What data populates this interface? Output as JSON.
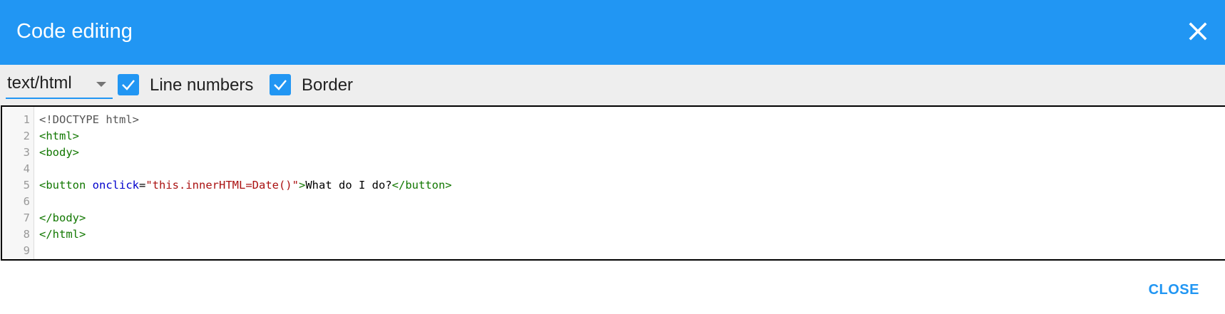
{
  "dialog": {
    "title": "Code editing",
    "close_icon": "close-icon",
    "close_button_label": "CLOSE"
  },
  "toolbar": {
    "mode_select": {
      "value": "text/html",
      "icon": "dropdown-arrow-icon"
    },
    "line_numbers": {
      "label": "Line numbers",
      "checked": true
    },
    "border": {
      "label": "Border",
      "checked": true
    }
  },
  "editor": {
    "line_numbers": [
      "1",
      "2",
      "3",
      "4",
      "5",
      "6",
      "7",
      "8",
      "9"
    ],
    "lines": [
      [
        {
          "t": "<!DOCTYPE html>",
          "k": "meta"
        }
      ],
      [
        {
          "t": "<html>",
          "k": "tag"
        }
      ],
      [
        {
          "t": "<body>",
          "k": "tag"
        }
      ],
      [],
      [
        {
          "t": "<button",
          "k": "tag"
        },
        {
          "t": " ",
          "k": "text"
        },
        {
          "t": "onclick",
          "k": "attr"
        },
        {
          "t": "=",
          "k": "text"
        },
        {
          "t": "\"this.innerHTML=Date()\"",
          "k": "str"
        },
        {
          "t": ">",
          "k": "tag"
        },
        {
          "t": "What do I do?",
          "k": "text"
        },
        {
          "t": "</button>",
          "k": "tag"
        }
      ],
      [],
      [
        {
          "t": "</body>",
          "k": "tag"
        }
      ],
      [
        {
          "t": "</html>",
          "k": "tag"
        }
      ],
      []
    ]
  },
  "colors": {
    "accent": "#2196f3",
    "toolbar_bg": "#eeeeee",
    "tag": "#117700",
    "attribute": "#0000cc",
    "string": "#aa1111",
    "meta": "#555555"
  }
}
